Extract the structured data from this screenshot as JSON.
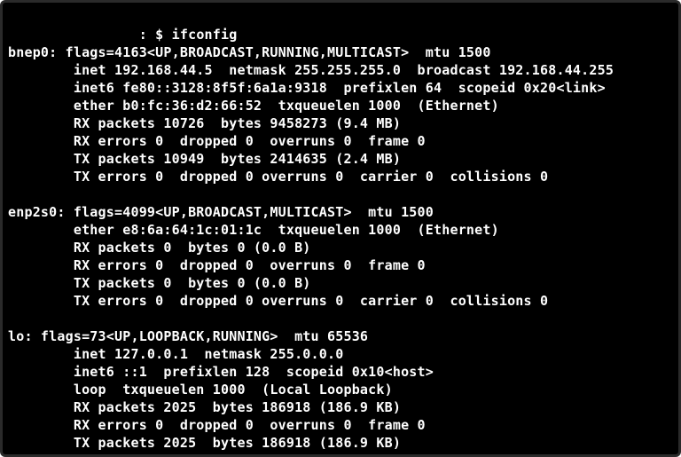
{
  "prompt": {
    "prefix": "                : $ ",
    "command": "ifconfig"
  },
  "interfaces": [
    {
      "name": "bnep0",
      "header": "flags=4163<UP,BROADCAST,RUNNING,MULTICAST>  mtu 1500",
      "lines": [
        "inet 192.168.44.5  netmask 255.255.255.0  broadcast 192.168.44.255",
        "inet6 fe80::3128:8f5f:6a1a:9318  prefixlen 64  scopeid 0x20<link>",
        "ether b0:fc:36:d2:66:52  txqueuelen 1000  (Ethernet)",
        "RX packets 10726  bytes 9458273 (9.4 MB)",
        "RX errors 0  dropped 0  overruns 0  frame 0",
        "TX packets 10949  bytes 2414635 (2.4 MB)",
        "TX errors 0  dropped 0 overruns 0  carrier 0  collisions 0"
      ]
    },
    {
      "name": "enp2s0",
      "header": "flags=4099<UP,BROADCAST,MULTICAST>  mtu 1500",
      "lines": [
        "ether e8:6a:64:1c:01:1c  txqueuelen 1000  (Ethernet)",
        "RX packets 0  bytes 0 (0.0 B)",
        "RX errors 0  dropped 0  overruns 0  frame 0",
        "TX packets 0  bytes 0 (0.0 B)",
        "TX errors 0  dropped 0 overruns 0  carrier 0  collisions 0"
      ]
    },
    {
      "name": "lo",
      "header": "flags=73<UP,LOOPBACK,RUNNING>  mtu 65536",
      "lines": [
        "inet 127.0.0.1  netmask 255.0.0.0",
        "inet6 ::1  prefixlen 128  scopeid 0x10<host>",
        "loop  txqueuelen 1000  (Local Loopback)",
        "RX packets 2025  bytes 186918 (186.9 KB)",
        "RX errors 0  dropped 0  overruns 0  frame 0",
        "TX packets 2025  bytes 186918 (186.9 KB)"
      ]
    }
  ]
}
